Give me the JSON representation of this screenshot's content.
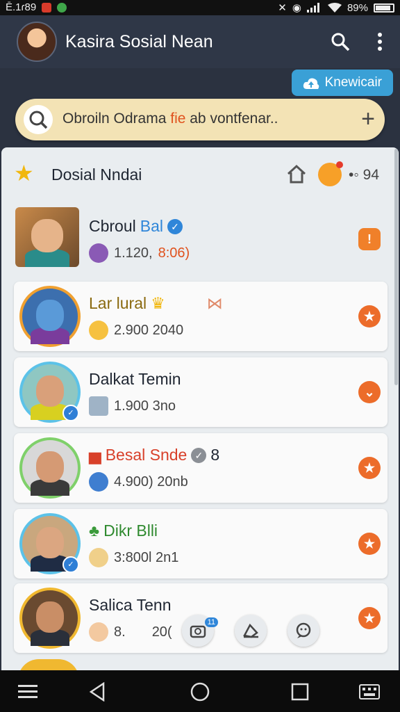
{
  "status_bar": {
    "time": "Ē.1ɾ89",
    "battery": "89%",
    "icons": [
      "notification-icon",
      "app-icon",
      "mute-icon",
      "wifi-calling-icon",
      "signal-icon",
      "wifi-icon",
      "battery-icon"
    ]
  },
  "app_bar": {
    "title": "Kasira Sosial Nean",
    "icons": [
      "search-icon",
      "more-vertical-icon"
    ]
  },
  "create_button": {
    "label": "Knewicair",
    "icon": "cloud-upload-icon"
  },
  "search": {
    "text_before": "Obroiln Odrama ",
    "text_highlight": "fie",
    "text_after": " ab vontfenar..",
    "icon": "search-icon",
    "add_icon": "plus-icon"
  },
  "panel": {
    "title": "Dosial Nndai",
    "count": "94",
    "icons": [
      "star-icon",
      "home-icon",
      "emoji-icon"
    ]
  },
  "items": [
    {
      "name_a": "Cbroul",
      "name_b": "Bal",
      "meta_a": "1.120,",
      "meta_b": "8:06)",
      "action": "info",
      "verified": true
    },
    {
      "name": "Lar lural",
      "meta": "2.900  2040",
      "action": "star"
    },
    {
      "name": "Dalkat Temin",
      "meta": "1.900  3no",
      "action": "check"
    },
    {
      "name": "Besal Snde",
      "extra": "8",
      "meta": "4.900) 20nb",
      "action": "star",
      "verified": true
    },
    {
      "name": "Dikr Blli",
      "meta": "3:800l  2n1",
      "action": "star"
    },
    {
      "name": "Salica Tenn",
      "meta": "8.",
      "meta_tail": "20(",
      "action": "star"
    }
  ],
  "float_actions": [
    {
      "icon": "camera-icon",
      "badge": "11"
    },
    {
      "icon": "notes-icon"
    },
    {
      "icon": "chat-icon"
    }
  ],
  "nav": [
    "menu-icon",
    "back-icon",
    "home-icon",
    "recents-icon",
    "keyboard-icon"
  ],
  "colors": {
    "accent": "#3aa0d6",
    "action": "#ec6c2a",
    "search_bg": "#f3e3b5",
    "appbar": "#2f3747"
  }
}
